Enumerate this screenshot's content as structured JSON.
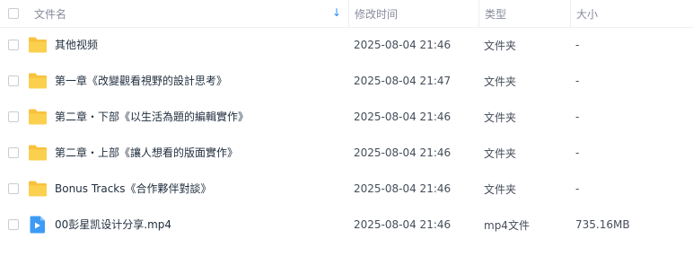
{
  "header": {
    "name_label": "文件名",
    "time_label": "修改时间",
    "type_label": "类型",
    "size_label": "大小",
    "sort_icon": "arrow-down-icon",
    "sort_color": "#2e8ef7"
  },
  "files": [
    {
      "name": "其他视频",
      "modified": "2025-08-04 21:46",
      "type": "文件夹",
      "size": "-",
      "icon": "folder-icon"
    },
    {
      "name": "第一章《改變觀看視野的設計思考》",
      "modified": "2025-08-04 21:47",
      "type": "文件夹",
      "size": "-",
      "icon": "folder-icon"
    },
    {
      "name": "第二章・下部《以生活為題的編輯實作》",
      "modified": "2025-08-04 21:46",
      "type": "文件夹",
      "size": "-",
      "icon": "folder-icon"
    },
    {
      "name": "第二章・上部《讓人想看的版面實作》",
      "modified": "2025-08-04 21:46",
      "type": "文件夹",
      "size": "-",
      "icon": "folder-icon"
    },
    {
      "name": "Bonus Tracks《合作夥伴對談》",
      "modified": "2025-08-04 21:46",
      "type": "文件夹",
      "size": "-",
      "icon": "folder-icon"
    },
    {
      "name": "00彭星凯设计分享.mp4",
      "modified": "2025-08-04 21:46",
      "type": "mp4文件",
      "size": "735.16MB",
      "icon": "video-file-icon"
    }
  ],
  "colors": {
    "folder": "#f9c23c",
    "video": "#3d9bf5",
    "text": "#1f2d3d",
    "muted": "#878c9c"
  }
}
